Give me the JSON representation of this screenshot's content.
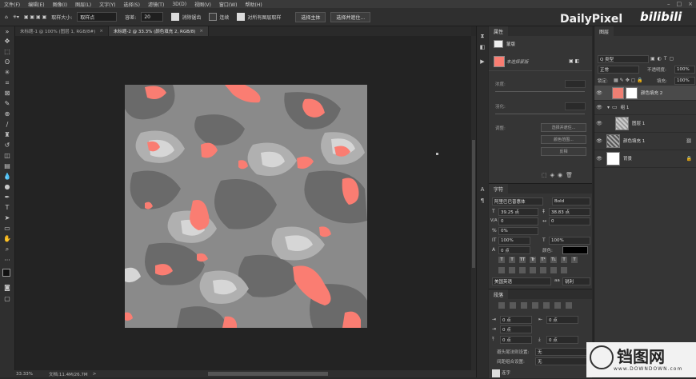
{
  "menubar": {
    "items": [
      "文件(F)",
      "编辑(E)",
      "图像(I)",
      "图层(L)",
      "文字(Y)",
      "选择(S)",
      "滤镜(T)",
      "3D(D)",
      "视图(V)",
      "窗口(W)",
      "帮助(H)"
    ],
    "window_controls": [
      "–",
      "□",
      "×"
    ]
  },
  "options_bar": {
    "sample_size_label": "取样大小:",
    "sample_size_value": "取样点",
    "tolerance_label": "容差:",
    "tolerance_value": "20",
    "anti_alias_label": "消除锯齿",
    "contiguous_label": "连续",
    "sample_all_layers_label": "对所有图层取样",
    "select_subject_button": "选择主体",
    "select_and_mask_button": "选择并遮住..."
  },
  "tabs": [
    {
      "label": "未标题-1 @ 100% (图层 1, RGB/8#)",
      "active": false
    },
    {
      "label": "未标题-2 @ 33.3% (颜色填充 2, RGB/8)",
      "active": true
    }
  ],
  "status_bar": {
    "zoom": "33.33%",
    "doc_info": "文档:11.4M/26.7M"
  },
  "properties_panel": {
    "tab": "属性",
    "subtitle": "蒙版",
    "mask_label": "未选择蒙版",
    "density_label": "浓度:",
    "feather_label": "羽化:",
    "refine_label": "调整:",
    "buttons": [
      "选择并遮住...",
      "颜色范围...",
      "反相"
    ]
  },
  "character_panel": {
    "tab": "字符",
    "font_family": "阿里巴巴普惠体",
    "font_style": "Bold",
    "font_size": "39.25 点",
    "leading": "38.83 点",
    "tracking_label": "V/A",
    "tracking_value": "0",
    "kerning_value": "0",
    "baseline": "0%",
    "vertical_scale": "100%",
    "horizontal_scale": "100%",
    "baseline_shift": "0 点",
    "color_label": "颜色:",
    "type_buttons": [
      "T",
      "T",
      "TT",
      "Tr",
      "T¹",
      "T₁",
      "T",
      "T"
    ],
    "language": "美国英语",
    "anti_alias": "锐利"
  },
  "paragraph_panel": {
    "tab": "段落",
    "indent_left": "0 点",
    "indent_right": "0 点",
    "indent_first": "0 点",
    "space_before": "0 点",
    "space_after": "0 点",
    "hyphen_label": "避头尾法则设置:",
    "hyphen_value": "无",
    "spacing_label": "间距组合设置:",
    "spacing_value": "无",
    "hyphenate_label": "连字"
  },
  "layers_panel": {
    "tab": "图层",
    "filter_kind": "Q 类型",
    "blend_mode": "正常",
    "opacity_label": "不透明度:",
    "opacity_value": "100%",
    "lock_label": "锁定:",
    "fill_label": "填充:",
    "fill_value": "100%",
    "layers": [
      {
        "name": "颜色填充 2",
        "selected": true,
        "thumb_color": "#ef7f73"
      },
      {
        "name": "组 1",
        "selected": false,
        "thumb_color": ""
      },
      {
        "name": "图层 1",
        "selected": false,
        "thumb_color": "#dcdcdc"
      },
      {
        "name": "颜色填充 1",
        "selected": false,
        "thumb_color": "#888888"
      },
      {
        "name": "背景",
        "selected": false,
        "thumb_color": "#ffffff"
      }
    ]
  },
  "logos": {
    "dailypixel": "DailyPixel",
    "bilibili": "bilibili",
    "watermark_title": "铛图网",
    "watermark_url": "www.DOWNDOWN.com"
  },
  "colors": {
    "accent_coral": "#fa7d72",
    "ui_dark": "#282828",
    "panel": "#353535"
  }
}
